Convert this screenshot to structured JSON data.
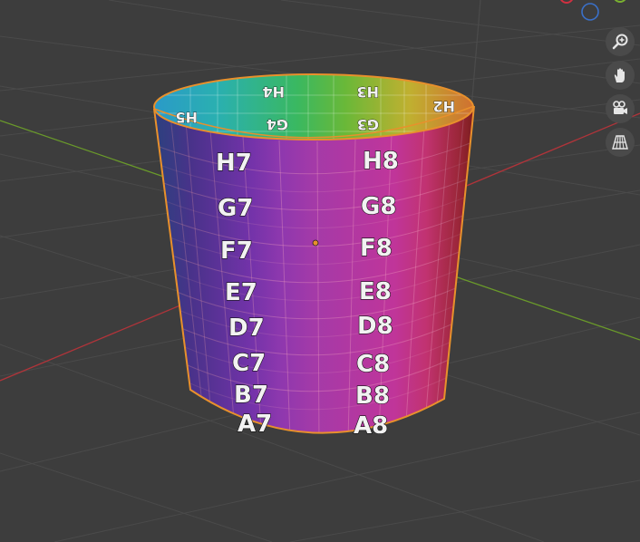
{
  "app": {
    "name": "3D Viewport"
  },
  "colors": {
    "background": "#3d3d3d",
    "grid": "#4a4a4a",
    "axis_x": "#b0343a",
    "axis_y": "#6a9a2a",
    "selection": "#e8902c",
    "nav_button": "#4a4a4a"
  },
  "nav_controls": [
    {
      "id": "zoom",
      "icon": "zoom-icon"
    },
    {
      "id": "pan",
      "icon": "hand-icon"
    },
    {
      "id": "camera",
      "icon": "camera-icon"
    },
    {
      "id": "perspective",
      "icon": "grid-perspective-icon"
    }
  ],
  "mesh": {
    "object": "Cylinder",
    "selected": true,
    "outer_labels_left": [
      "H7",
      "G7",
      "F7",
      "E7",
      "D7",
      "C7",
      "B7",
      "A7"
    ],
    "outer_labels_right": [
      "H8",
      "G8",
      "F8",
      "E8",
      "D8",
      "C8",
      "B8",
      "A8"
    ],
    "inner_top_labels": [
      "H5",
      "H4",
      "H3",
      "H2"
    ],
    "inner_lower_labels": [
      "G4",
      "G3"
    ]
  }
}
